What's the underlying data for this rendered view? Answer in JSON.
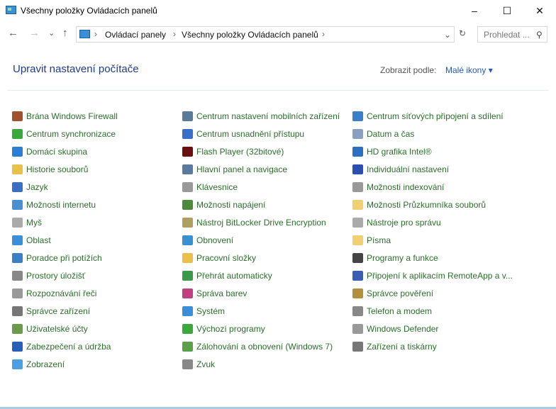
{
  "window": {
    "title": "Všechny položky Ovládacích panelů",
    "minimize": "–",
    "maximize": "☐",
    "close": "✕"
  },
  "nav": {
    "back": "←",
    "forward": "→",
    "recent": "⌄",
    "up": "↑",
    "breadcrumb": [
      "Ovládací panely",
      "Všechny položky Ovládacích panelů"
    ],
    "dropdown": "⌄",
    "refresh": "↻",
    "search_placeholder": "Prohledat ...",
    "search_icon": "⚲"
  },
  "header": {
    "title": "Upravit nastavení počítače",
    "view_label": "Zobrazit podle:",
    "view_value": "Malé ikony ▾"
  },
  "columns": [
    [
      {
        "label": "Brána Windows Firewall",
        "color": "#a0522d"
      },
      {
        "label": "Centrum synchronizace",
        "color": "#3aa83a"
      },
      {
        "label": "Domácí skupina",
        "color": "#2a7fd4"
      },
      {
        "label": "Historie souborů",
        "color": "#e8c04a"
      },
      {
        "label": "Jazyk",
        "color": "#3a6fc8"
      },
      {
        "label": "Možnosti internetu",
        "color": "#4a8fd0"
      },
      {
        "label": "Myš",
        "color": "#aaaaaa"
      },
      {
        "label": "Oblast",
        "color": "#3a8fd8"
      },
      {
        "label": "Poradce při potížích",
        "color": "#3a7fc8"
      },
      {
        "label": "Prostory úložišť",
        "color": "#888888"
      },
      {
        "label": "Rozpoznávání řeči",
        "color": "#999999"
      },
      {
        "label": "Správce zařízení",
        "color": "#777777"
      },
      {
        "label": "Uživatelské účty",
        "color": "#6a9a4a"
      },
      {
        "label": "Zabezpečení a údržba",
        "color": "#2a5fb8"
      },
      {
        "label": "Zobrazení",
        "color": "#4a9fe0"
      }
    ],
    [
      {
        "label": "Centrum nastavení mobilních zařízení",
        "color": "#5a7a9a"
      },
      {
        "label": "Centrum usnadnění přístupu",
        "color": "#3a6fc8"
      },
      {
        "label": "Flash Player (32bitové)",
        "color": "#6a1010"
      },
      {
        "label": "Hlavní panel a navigace",
        "color": "#5a7aa0"
      },
      {
        "label": "Klávesnice",
        "color": "#999999"
      },
      {
        "label": "Možnosti napájení",
        "color": "#4a8a3a"
      },
      {
        "label": "Nástroj BitLocker Drive Encryption",
        "color": "#b0a060"
      },
      {
        "label": "Obnovení",
        "color": "#3a8fd0"
      },
      {
        "label": "Pracovní složky",
        "color": "#e8c04a"
      },
      {
        "label": "Přehrát automaticky",
        "color": "#3a9a4a"
      },
      {
        "label": "Správa barev",
        "color": "#c04080"
      },
      {
        "label": "Systém",
        "color": "#3a8fd8"
      },
      {
        "label": "Výchozí programy",
        "color": "#3aa83a"
      },
      {
        "label": "Zálohování a obnovení (Windows 7)",
        "color": "#5aa04a"
      },
      {
        "label": "Zvuk",
        "color": "#888888"
      }
    ],
    [
      {
        "label": "Centrum síťových připojení a sdílení",
        "color": "#3a7fc8"
      },
      {
        "label": "Datum a čas",
        "color": "#8aa0c0"
      },
      {
        "label": "HD grafika Intel®",
        "color": "#2a6fc0"
      },
      {
        "label": "Individuální nastavení",
        "color": "#2a4fb0"
      },
      {
        "label": "Možnosti indexování",
        "color": "#999999"
      },
      {
        "label": "Možnosti Průzkumníka souborů",
        "color": "#f0d070"
      },
      {
        "label": "Nástroje pro správu",
        "color": "#aaaaaa"
      },
      {
        "label": "Písma",
        "color": "#f0d070"
      },
      {
        "label": "Programy a funkce",
        "color": "#444444"
      },
      {
        "label": "Připojení k aplikacím RemoteApp a v...",
        "color": "#3a5fb0"
      },
      {
        "label": "Správce pověření",
        "color": "#b0903a"
      },
      {
        "label": "Telefon a modem",
        "color": "#888888"
      },
      {
        "label": "Windows Defender",
        "color": "#999999"
      },
      {
        "label": "Zařízení a tiskárny",
        "color": "#777777"
      }
    ]
  ]
}
